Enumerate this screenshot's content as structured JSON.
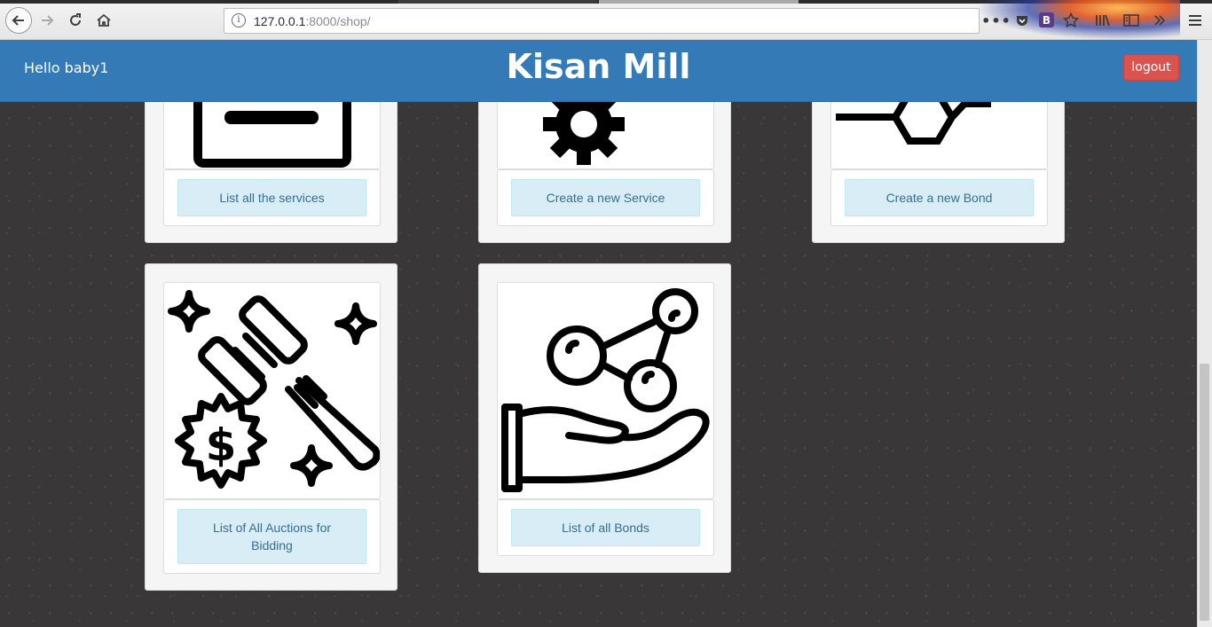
{
  "browser": {
    "url_host": "127.0.0.1",
    "url_rest": ":8000/shop/"
  },
  "header": {
    "greeting": "Hello baby1",
    "brand": "Kisan Mill",
    "logout_label": "logout"
  },
  "cards": [
    {
      "icon": "services-icon",
      "button_label": "List all the services"
    },
    {
      "icon": "gears-icon",
      "button_label": "Create a new Service"
    },
    {
      "icon": "bond-molecule-icon",
      "button_label": "Create a new Bond"
    },
    {
      "icon": "auction-gavel-icon",
      "button_label": "List of All Auctions for Bidding"
    },
    {
      "icon": "hand-molecule-icon",
      "button_label": "List of all Bonds"
    }
  ],
  "colors": {
    "navbar": "#337ab7",
    "logout": "#d9534f",
    "info_button_bg": "#d9edf7",
    "info_button_text": "#31708f"
  }
}
